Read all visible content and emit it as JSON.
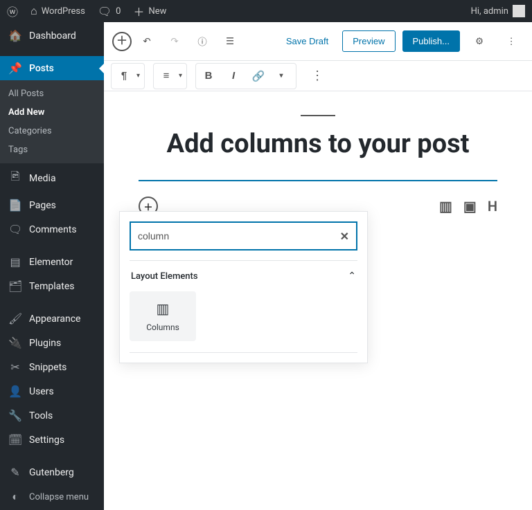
{
  "adminBar": {
    "site": "WordPress",
    "comments": "0",
    "new": "New",
    "greeting": "Hi, admin"
  },
  "sidebar": {
    "dashboard": "Dashboard",
    "posts": "Posts",
    "postsSub": {
      "all": "All Posts",
      "addNew": "Add New",
      "categories": "Categories",
      "tags": "Tags"
    },
    "media": "Media",
    "pages": "Pages",
    "comments": "Comments",
    "elementor": "Elementor",
    "templates": "Templates",
    "appearance": "Appearance",
    "plugins": "Plugins",
    "snippets": "Snippets",
    "users": "Users",
    "tools": "Tools",
    "settings": "Settings",
    "gutenberg": "Gutenberg",
    "collapse": "Collapse menu"
  },
  "editorHeader": {
    "saveDraft": "Save Draft",
    "preview": "Preview",
    "publish": "Publish..."
  },
  "post": {
    "title": "Add columns to your post"
  },
  "inserter": {
    "searchValue": "column",
    "sectionTitle": "Layout Elements",
    "blocks": [
      {
        "label": "Columns",
        "icon": "columns"
      }
    ]
  },
  "shortcuts": {
    "columnsGlyph": "▥",
    "imageGlyph": "▣",
    "headingGlyph": "H"
  }
}
